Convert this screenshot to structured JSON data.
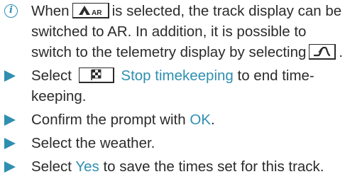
{
  "info_note": {
    "text_before_ar_button": "When",
    "ar_button_label": "AR",
    "text_after_ar_button": "is selected, the track display can be switched to AR. In addition, it is possible to switch to the telemetry display by selecting",
    "text_after_telemetry_button": "."
  },
  "steps": [
    {
      "before_button": "Select",
      "ui_term": "Stop timekeeping",
      "after": "to end time-keeping."
    },
    {
      "before": "Confirm the prompt with",
      "ui_term": "OK",
      "after": "."
    },
    {
      "text": "Select the weather."
    },
    {
      "before": "Select",
      "ui_term": "Yes",
      "after": "to save the times set for this track."
    }
  ],
  "colors": {
    "accent": "#2f8fb0",
    "text": "#2b2b2b"
  },
  "icons": {
    "info": "info-circle-icon",
    "bullet": "triangle-bullet-icon",
    "ar_button": "ar-track-icon",
    "telemetry_button": "telemetry-curve-icon",
    "stop_timekeeping_button": "checkered-flag-icon"
  }
}
